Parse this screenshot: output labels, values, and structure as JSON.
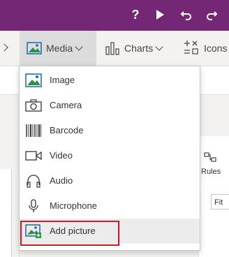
{
  "topbar": {
    "help_icon": "question-icon",
    "play_icon": "play-icon",
    "undo_icon": "undo-icon",
    "redo_icon": "redo-icon",
    "colors": {
      "background": "#742774"
    }
  },
  "ribbon": {
    "media_label": "Media",
    "charts_label": "Charts",
    "icons_label": "Icons"
  },
  "menu": {
    "items": [
      {
        "label": "Image",
        "icon": "image-icon"
      },
      {
        "label": "Camera",
        "icon": "camera-icon"
      },
      {
        "label": "Barcode",
        "icon": "barcode-icon"
      },
      {
        "label": "Video",
        "icon": "video-icon"
      },
      {
        "label": "Audio",
        "icon": "headphones-icon"
      },
      {
        "label": "Microphone",
        "icon": "microphone-icon"
      },
      {
        "label": "Add picture",
        "icon": "add-picture-icon",
        "selected": true
      }
    ],
    "highlight_color": "#e0121f"
  },
  "right_pane": {
    "rules_label": "Rules",
    "fit_value": "Fit"
  }
}
